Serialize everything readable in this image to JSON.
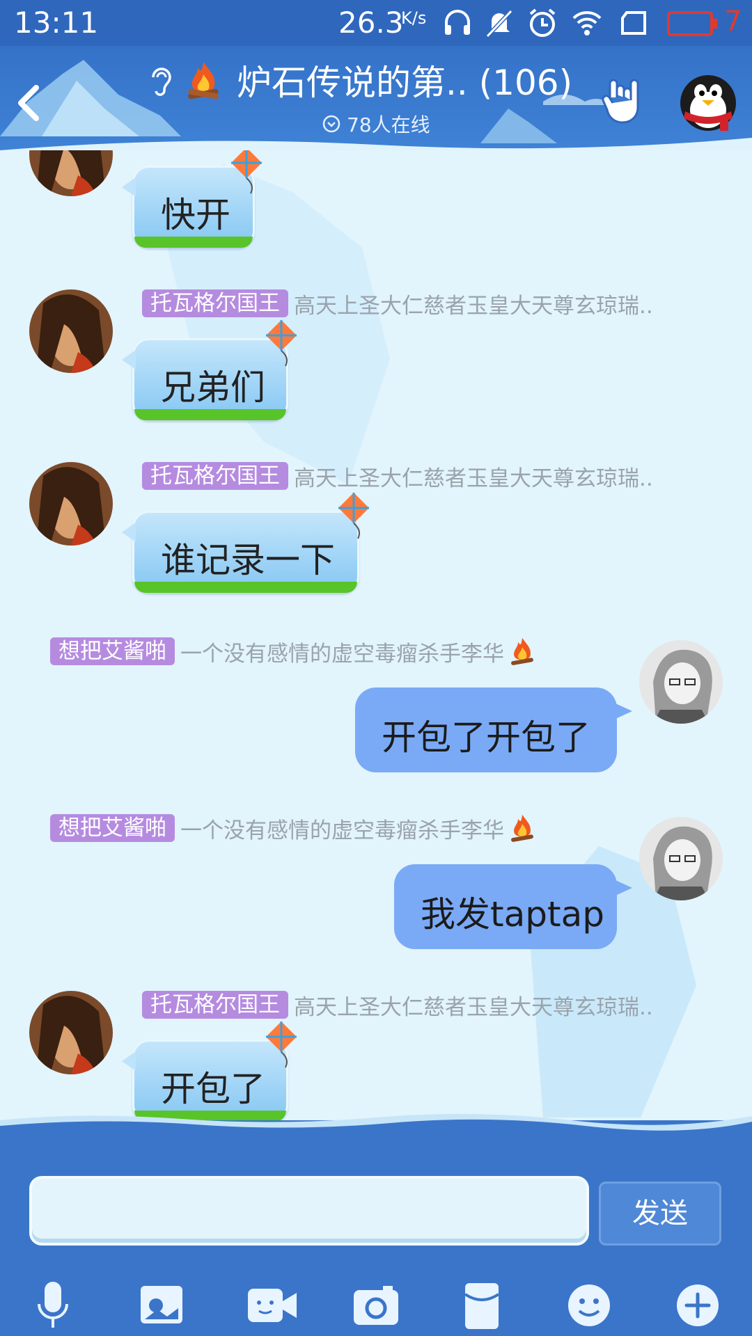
{
  "status_bar": {
    "time": "13:11",
    "net_speed": "26.3",
    "net_speed_unit": "K/s",
    "battery_level": "7"
  },
  "header": {
    "title": "炉石传说的第.. (106)",
    "online_count": "78人在线"
  },
  "messages": [
    {
      "side": "left",
      "sender_badge": "",
      "sender_name": "",
      "text": "快开"
    },
    {
      "side": "left",
      "sender_badge": "托瓦格尔国王",
      "sender_name": "高天上圣大仁慈者玉皇大天尊玄琼瑞..",
      "text": "兄弟们"
    },
    {
      "side": "left",
      "sender_badge": "托瓦格尔国王",
      "sender_name": "高天上圣大仁慈者玉皇大天尊玄琼瑞..",
      "text": "谁记录一下"
    },
    {
      "side": "right",
      "sender_badge": "想把艾酱啪",
      "sender_name": "一个没有感情的虚空毒瘤杀手李华",
      "text": "开包了开包了"
    },
    {
      "side": "right",
      "sender_badge": "想把艾酱啪",
      "sender_name": "一个没有感情的虚空毒瘤杀手李华",
      "text": "我发taptap"
    },
    {
      "side": "left",
      "sender_badge": "托瓦格尔国王",
      "sender_name": "高天上圣大仁慈者玉皇大天尊玄琼瑞..",
      "text": "开包了"
    }
  ],
  "input": {
    "value": "",
    "send_label": "发送"
  },
  "toolbar": {
    "items": [
      "voice",
      "image",
      "video",
      "camera",
      "red-packet",
      "emoji",
      "more"
    ]
  },
  "colors": {
    "header_blue": "#3472c8",
    "badge_purple": "#b58be0",
    "right_bubble": "#7aaaf6",
    "battery_red": "#e03a2f"
  }
}
